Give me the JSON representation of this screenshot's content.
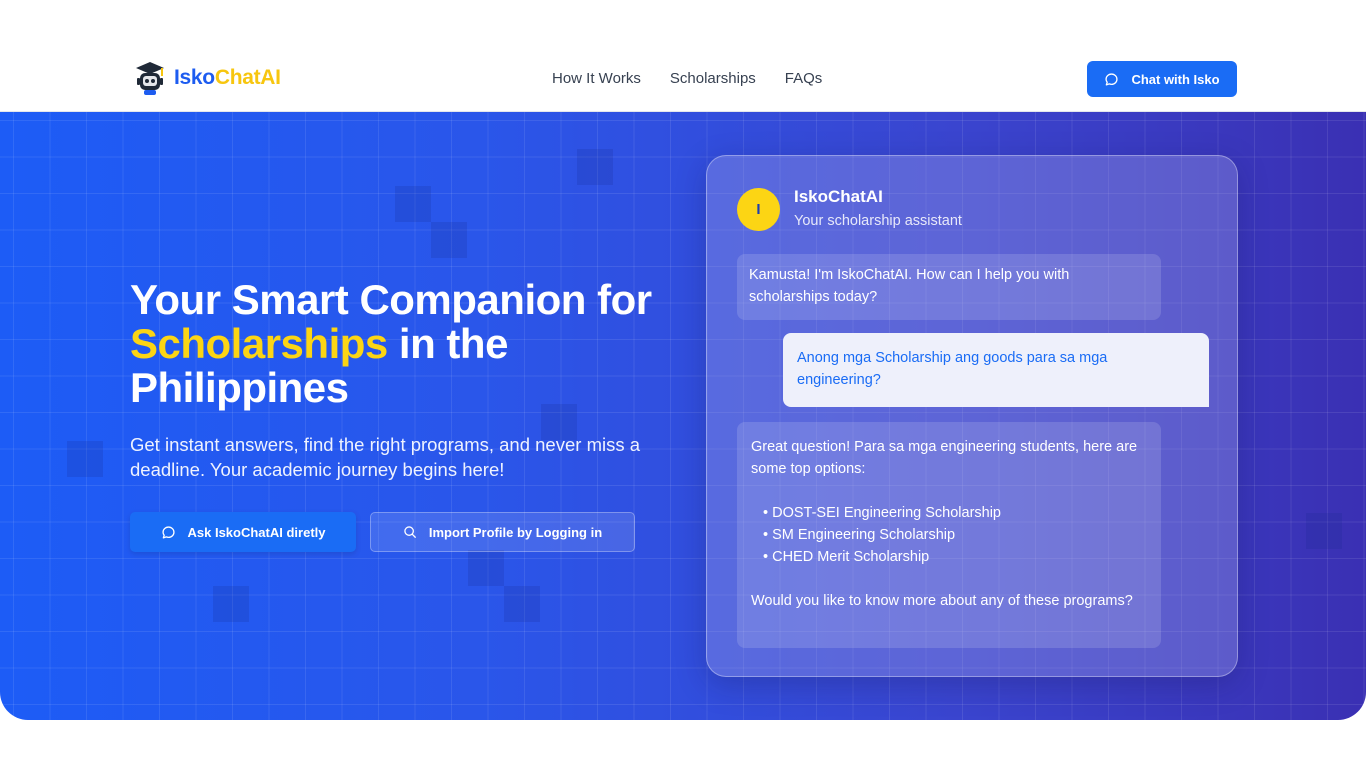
{
  "nav": {
    "brand_part1": "Isko",
    "brand_part2": "ChatAI",
    "links": [
      "How It Works",
      "Scholarships",
      "FAQs"
    ],
    "cta_label": "Chat with Isko"
  },
  "hero": {
    "headline_part1": "Your Smart Companion for ",
    "headline_highlight": "Scholarships",
    "headline_part2": " in the Philippines",
    "subtitle": "Get instant answers, find the right programs, and never miss a deadline. Your academic journey begins here!",
    "primary_button": "Ask IskoChatAI diretly",
    "secondary_button": "Import Profile by Logging in"
  },
  "chat": {
    "avatar_letter": "I",
    "bot_name": "IskoChatAI",
    "bot_subtitle": "Your scholarship assistant",
    "greeting": "Kamusta! I'm IskoChatAI. How can I help you with scholarships today?",
    "user_message": "Anong mga Scholarship ang goods para sa mga engineering?",
    "reply_intro": "Great question! Para sa mga engineering students, here are some top options:",
    "reply_options": [
      "DOST-SEI Engineering Scholarship",
      "SM Engineering Scholarship",
      "CHED Merit Scholarship"
    ],
    "reply_outro": "Would you like to know more about any of these programs?"
  },
  "colors": {
    "brand_blue": "#1a6cf5",
    "brand_yellow": "#fcd514"
  }
}
